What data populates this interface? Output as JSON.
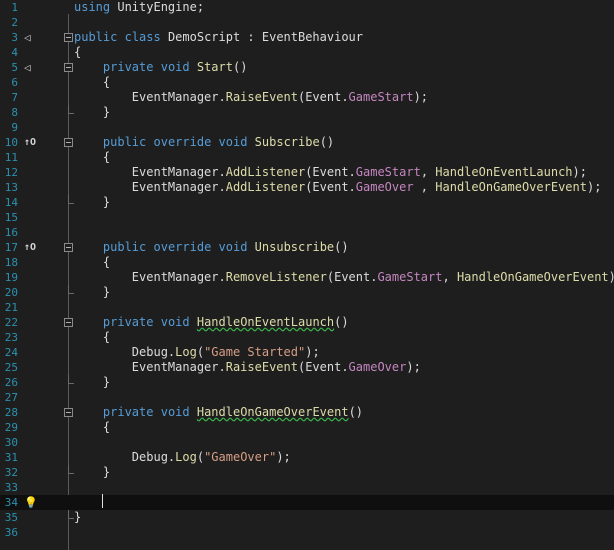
{
  "editor": {
    "lines": [
      {
        "n": "1",
        "glyph": "",
        "segs": [
          {
            "t": "using",
            "c": "kw"
          },
          {
            "t": " UnityEngine;",
            "c": "pl"
          }
        ]
      },
      {
        "n": "2",
        "glyph": "",
        "segs": []
      },
      {
        "n": "3",
        "glyph": "unity",
        "segs": [
          {
            "t": "public",
            "c": "kw"
          },
          {
            "t": " ",
            "c": "pl"
          },
          {
            "t": "class",
            "c": "kw"
          },
          {
            "t": " DemoScript : EventBehaviour",
            "c": "pl"
          }
        ]
      },
      {
        "n": "4",
        "glyph": "",
        "segs": [
          {
            "t": "{",
            "c": "pl"
          }
        ]
      },
      {
        "n": "5",
        "glyph": "unity",
        "segs": [
          {
            "t": "    ",
            "c": "pl"
          },
          {
            "t": "private",
            "c": "kw"
          },
          {
            "t": " ",
            "c": "pl"
          },
          {
            "t": "void",
            "c": "kw"
          },
          {
            "t": " ",
            "c": "pl"
          },
          {
            "t": "Start",
            "c": "fn"
          },
          {
            "t": "()",
            "c": "pl"
          }
        ]
      },
      {
        "n": "6",
        "glyph": "",
        "segs": [
          {
            "t": "    {",
            "c": "pl"
          }
        ]
      },
      {
        "n": "7",
        "glyph": "",
        "segs": [
          {
            "t": "        EventManager.",
            "c": "pl"
          },
          {
            "t": "RaiseEvent",
            "c": "fn"
          },
          {
            "t": "(Event.",
            "c": "pl"
          },
          {
            "t": "GameStart",
            "c": "ev"
          },
          {
            "t": ");",
            "c": "pl"
          }
        ]
      },
      {
        "n": "8",
        "glyph": "",
        "segs": [
          {
            "t": "    }",
            "c": "pl"
          }
        ]
      },
      {
        "n": "9",
        "glyph": "",
        "segs": []
      },
      {
        "n": "10",
        "glyph": "override",
        "segs": [
          {
            "t": "    ",
            "c": "pl"
          },
          {
            "t": "public",
            "c": "kw"
          },
          {
            "t": " ",
            "c": "pl"
          },
          {
            "t": "override",
            "c": "kw"
          },
          {
            "t": " ",
            "c": "pl"
          },
          {
            "t": "void",
            "c": "kw"
          },
          {
            "t": " ",
            "c": "pl"
          },
          {
            "t": "Subscribe",
            "c": "fn"
          },
          {
            "t": "()",
            "c": "pl"
          }
        ]
      },
      {
        "n": "11",
        "glyph": "",
        "segs": [
          {
            "t": "    {",
            "c": "pl"
          }
        ]
      },
      {
        "n": "12",
        "glyph": "",
        "segs": [
          {
            "t": "        EventManager.",
            "c": "pl"
          },
          {
            "t": "AddListener",
            "c": "fn"
          },
          {
            "t": "(Event.",
            "c": "pl"
          },
          {
            "t": "GameStart",
            "c": "ev"
          },
          {
            "t": ", ",
            "c": "pl"
          },
          {
            "t": "HandleOnEventLaunch",
            "c": "fn"
          },
          {
            "t": ");",
            "c": "pl"
          }
        ]
      },
      {
        "n": "13",
        "glyph": "",
        "segs": [
          {
            "t": "        EventManager.",
            "c": "pl"
          },
          {
            "t": "AddListener",
            "c": "fn"
          },
          {
            "t": "(Event.",
            "c": "pl"
          },
          {
            "t": "GameOver",
            "c": "ev"
          },
          {
            "t": " , ",
            "c": "pl"
          },
          {
            "t": "HandleOnGameOverEvent",
            "c": "fn"
          },
          {
            "t": ");",
            "c": "pl"
          }
        ]
      },
      {
        "n": "14",
        "glyph": "",
        "segs": [
          {
            "t": "    }",
            "c": "pl"
          }
        ]
      },
      {
        "n": "15",
        "glyph": "",
        "segs": []
      },
      {
        "n": "16",
        "glyph": "",
        "segs": []
      },
      {
        "n": "17",
        "glyph": "override",
        "segs": [
          {
            "t": "    ",
            "c": "pl"
          },
          {
            "t": "public",
            "c": "kw"
          },
          {
            "t": " ",
            "c": "pl"
          },
          {
            "t": "override",
            "c": "kw"
          },
          {
            "t": " ",
            "c": "pl"
          },
          {
            "t": "void",
            "c": "kw"
          },
          {
            "t": " ",
            "c": "pl"
          },
          {
            "t": "Unsubscribe",
            "c": "fn"
          },
          {
            "t": "()",
            "c": "pl"
          }
        ]
      },
      {
        "n": "18",
        "glyph": "",
        "segs": [
          {
            "t": "    {",
            "c": "pl"
          }
        ]
      },
      {
        "n": "19",
        "glyph": "",
        "segs": [
          {
            "t": "        EventManager.",
            "c": "pl"
          },
          {
            "t": "RemoveListener",
            "c": "fn"
          },
          {
            "t": "(Event.",
            "c": "pl"
          },
          {
            "t": "GameStart",
            "c": "ev"
          },
          {
            "t": ", ",
            "c": "pl"
          },
          {
            "t": "HandleOnGameOverEvent",
            "c": "fn"
          },
          {
            "t": ");",
            "c": "pl"
          }
        ]
      },
      {
        "n": "20",
        "glyph": "",
        "segs": [
          {
            "t": "    }",
            "c": "pl"
          }
        ]
      },
      {
        "n": "21",
        "glyph": "",
        "segs": []
      },
      {
        "n": "22",
        "glyph": "",
        "segs": [
          {
            "t": "    ",
            "c": "pl"
          },
          {
            "t": "private",
            "c": "kw"
          },
          {
            "t": " ",
            "c": "pl"
          },
          {
            "t": "void",
            "c": "kw"
          },
          {
            "t": " ",
            "c": "pl"
          },
          {
            "t": "HandleOnEventLaunch",
            "c": "fn",
            "sq": true
          },
          {
            "t": "()",
            "c": "pl"
          }
        ]
      },
      {
        "n": "23",
        "glyph": "",
        "segs": [
          {
            "t": "    {",
            "c": "pl"
          }
        ]
      },
      {
        "n": "24",
        "glyph": "",
        "segs": [
          {
            "t": "        Debug.",
            "c": "pl"
          },
          {
            "t": "Log",
            "c": "fn"
          },
          {
            "t": "(",
            "c": "pl"
          },
          {
            "t": "\"Game Started\"",
            "c": "str"
          },
          {
            "t": ");",
            "c": "pl"
          }
        ]
      },
      {
        "n": "25",
        "glyph": "",
        "segs": [
          {
            "t": "        EventManager.",
            "c": "pl"
          },
          {
            "t": "RaiseEvent",
            "c": "fn"
          },
          {
            "t": "(Event.",
            "c": "pl"
          },
          {
            "t": "GameOver",
            "c": "ev"
          },
          {
            "t": ");",
            "c": "pl"
          }
        ]
      },
      {
        "n": "26",
        "glyph": "",
        "segs": [
          {
            "t": "    }",
            "c": "pl"
          }
        ]
      },
      {
        "n": "27",
        "glyph": "",
        "segs": []
      },
      {
        "n": "28",
        "glyph": "",
        "segs": [
          {
            "t": "    ",
            "c": "pl"
          },
          {
            "t": "private",
            "c": "kw"
          },
          {
            "t": " ",
            "c": "pl"
          },
          {
            "t": "void",
            "c": "kw"
          },
          {
            "t": " ",
            "c": "pl"
          },
          {
            "t": "HandleOnGameOverEvent",
            "c": "fn",
            "sq": true
          },
          {
            "t": "()",
            "c": "pl"
          }
        ]
      },
      {
        "n": "29",
        "glyph": "",
        "segs": [
          {
            "t": "    {",
            "c": "pl"
          }
        ]
      },
      {
        "n": "30",
        "glyph": "",
        "segs": []
      },
      {
        "n": "31",
        "glyph": "",
        "segs": [
          {
            "t": "        Debug.",
            "c": "pl"
          },
          {
            "t": "Log",
            "c": "fn"
          },
          {
            "t": "(",
            "c": "pl"
          },
          {
            "t": "\"GameOver\"",
            "c": "str"
          },
          {
            "t": ");",
            "c": "pl"
          }
        ]
      },
      {
        "n": "32",
        "glyph": "",
        "segs": [
          {
            "t": "    }",
            "c": "pl"
          }
        ]
      },
      {
        "n": "33",
        "glyph": "",
        "segs": []
      },
      {
        "n": "34",
        "glyph": "bulb",
        "segs": []
      },
      {
        "n": "35",
        "glyph": "",
        "segs": [
          {
            "t": "}",
            "c": "pl"
          }
        ]
      },
      {
        "n": "36",
        "glyph": "",
        "segs": []
      }
    ],
    "current_line": "34",
    "glyph_chars": {
      "unity": "◁",
      "override": "↑O",
      "bulb": "💡"
    },
    "fold_start_lines": [
      "3",
      "5",
      "10",
      "17",
      "22",
      "28"
    ],
    "fold_end_lines": [
      "8",
      "14",
      "20",
      "26",
      "32",
      "35"
    ]
  }
}
